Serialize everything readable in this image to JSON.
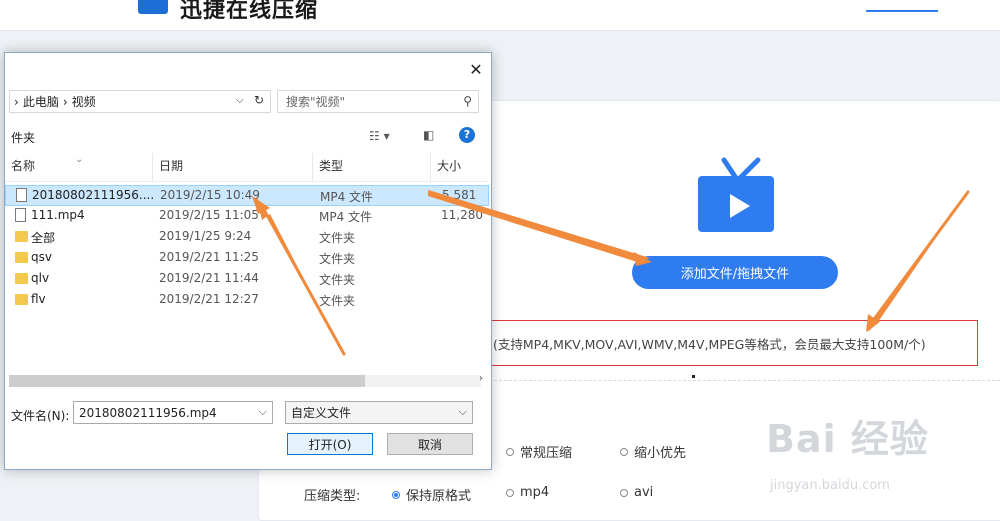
{
  "site": {
    "logo_text": "迅捷在线压缩",
    "add_button": "添加文件/拖拽文件",
    "formats_note": "(支持MP4,MKV,MOV,AVI,WMV,M4V,MPEG等格式，会员最大支持100M/个)",
    "compress_options": [
      {
        "label": "常规压缩",
        "selected": false
      },
      {
        "label": "缩小优先",
        "selected": false
      }
    ],
    "compress_type_label": "压缩类型:",
    "type_options": [
      {
        "label": "保持原格式",
        "selected": true
      },
      {
        "label": "mp4",
        "selected": false
      },
      {
        "label": "avi",
        "selected": false
      }
    ],
    "accent_color": "#2f7bf0",
    "highlight_color": "#e0393e"
  },
  "watermark": {
    "text": "Bai 经验",
    "url": "jingyan.baidu.com"
  },
  "dialog": {
    "close_glyph": "✕",
    "breadcrumb": [
      "此电脑",
      "视频"
    ],
    "search_placeholder": "搜索\"视频\"",
    "toolbar_label": "件夹",
    "columns": [
      "名称",
      "日期",
      "类型",
      "大小"
    ],
    "files": [
      {
        "name": "20180802111956....",
        "date": "2019/2/15 10:49",
        "type": "MP4 文件",
        "size": "5,581",
        "kind": "file",
        "selected": true
      },
      {
        "name": "111.mp4",
        "date": "2019/2/15 11:05",
        "type": "MP4 文件",
        "size": "11,280",
        "kind": "file",
        "selected": false
      },
      {
        "name": "全部",
        "date": "2019/1/25 9:24",
        "type": "文件夹",
        "size": "",
        "kind": "folder",
        "selected": false
      },
      {
        "name": "qsv",
        "date": "2019/2/21 11:25",
        "type": "文件夹",
        "size": "",
        "kind": "folder",
        "selected": false
      },
      {
        "name": "qlv",
        "date": "2019/2/21 11:44",
        "type": "文件夹",
        "size": "",
        "kind": "folder",
        "selected": false
      },
      {
        "name": "flv",
        "date": "2019/2/21 12:27",
        "type": "文件夹",
        "size": "",
        "kind": "folder",
        "selected": false
      }
    ],
    "filename_label": "文件名(N):",
    "filename_value": "20180802111956.mp4",
    "filetype_value": "自定义文件",
    "open_button": "打开(O)",
    "cancel_button": "取消"
  }
}
